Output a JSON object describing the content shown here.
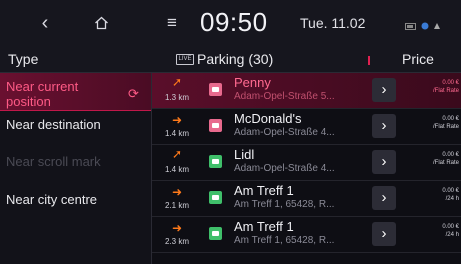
{
  "topbar": {
    "time": "09:50",
    "date": "Tue. 11.02"
  },
  "header": {
    "type_label": "Type",
    "live_badge": "LIVE",
    "parking_title": "Parking (30)",
    "price_label": "Price"
  },
  "sidebar": {
    "items": [
      {
        "label": "Near current position",
        "state": "active"
      },
      {
        "label": "Near destination",
        "state": "normal"
      },
      {
        "label": "Near scroll mark",
        "state": "disabled"
      },
      {
        "label": "Near city centre",
        "state": "normal"
      }
    ]
  },
  "parking_list": [
    {
      "distance": "1.3 km",
      "name": "Penny",
      "address": "Adam-Opel-Straße 5...",
      "price_amount": "0.00 €",
      "price_unit": "/Flat Rate",
      "badge": "pink",
      "active": true
    },
    {
      "distance": "1.4 km",
      "name": "McDonald's",
      "address": "Adam-Opel-Straße 4...",
      "price_amount": "0.00 €",
      "price_unit": "/Flat Rate",
      "badge": "pink",
      "active": false
    },
    {
      "distance": "1.4 km",
      "name": "Lidl",
      "address": "Adam-Opel-Straße 4...",
      "price_amount": "0.00 €",
      "price_unit": "/Flat Rate",
      "badge": "green",
      "active": false
    },
    {
      "distance": "2.1 km",
      "name": "Am Treff 1",
      "address": "Am Treff 1, 65428, R...",
      "price_amount": "0.00 €",
      "price_unit": "/24 h",
      "badge": "green",
      "active": false
    },
    {
      "distance": "2.3 km",
      "name": "Am Treff 1",
      "address": "Am Treff 1, 65428, R...",
      "price_amount": "0.00 €",
      "price_unit": "/24 h",
      "badge": "green",
      "active": false
    }
  ],
  "colors": {
    "accent": "#ff5a86",
    "direction_arrow": "#ff7a1a",
    "background": "#0e0e14"
  },
  "icons": {
    "back": "back-arrow-icon",
    "home": "home-icon",
    "menu": "menu-icon",
    "refresh": "refresh-icon",
    "parking": "parking-badge-icon",
    "details": "chevron-right-icon"
  }
}
